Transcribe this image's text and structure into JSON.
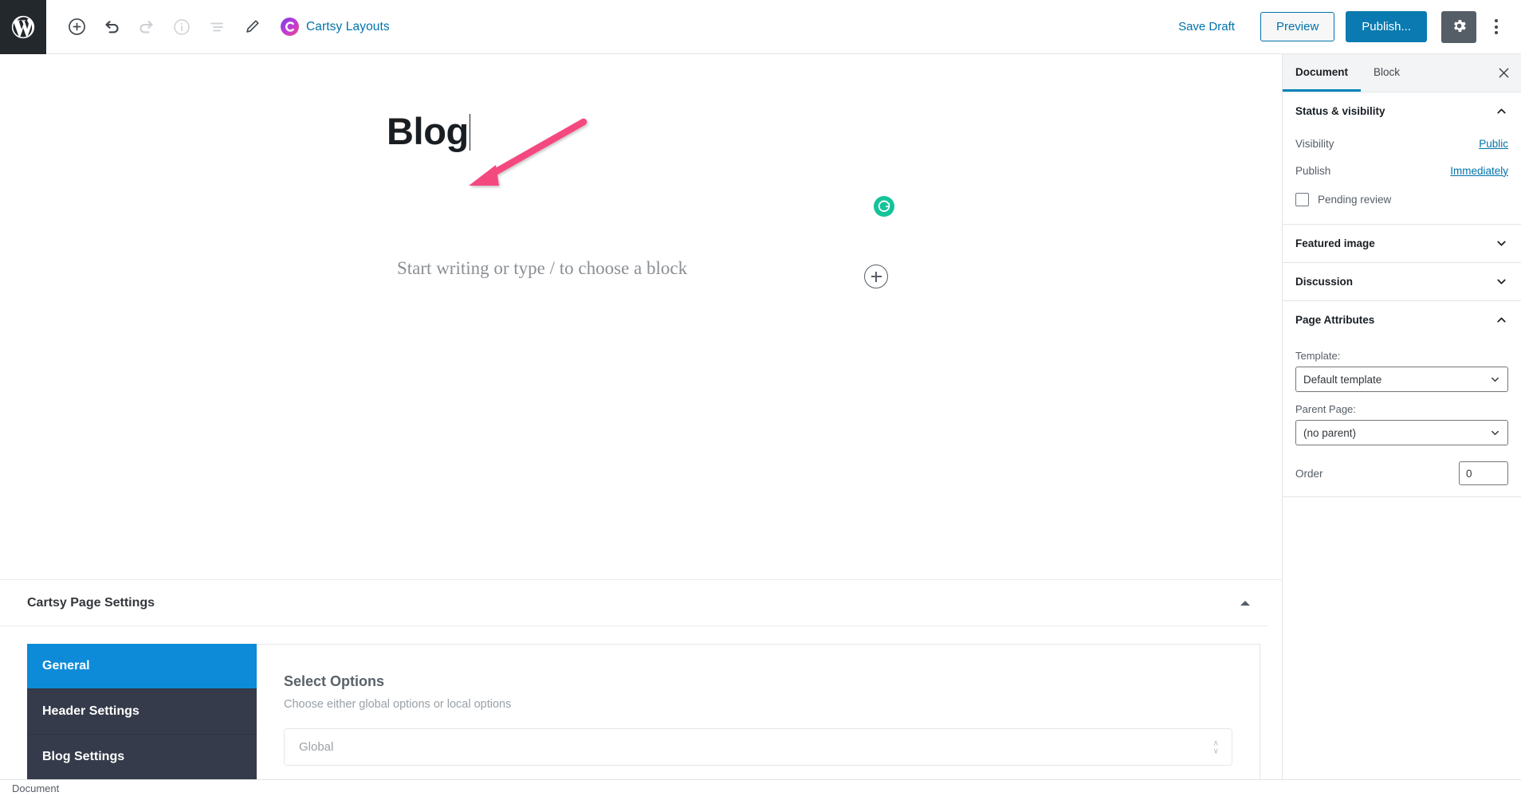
{
  "toolbar": {
    "wp_logo_icon": "wordpress-logo-icon",
    "left_tools": [
      {
        "name": "add-block-button",
        "icon": "plus-circle-icon",
        "disabled": false
      },
      {
        "name": "undo-button",
        "icon": "undo-arrow-icon",
        "disabled": false
      },
      {
        "name": "redo-button",
        "icon": "redo-arrow-icon",
        "disabled": true
      },
      {
        "name": "content-structure-button",
        "icon": "info-circle-icon",
        "disabled": true
      },
      {
        "name": "block-navigation-button",
        "icon": "list-view-icon",
        "disabled": true
      },
      {
        "name": "edit-mode-button",
        "icon": "pencil-icon",
        "disabled": false
      }
    ],
    "brand_label": "Cartsy Layouts",
    "brand_icon": "cartsy-logo-icon",
    "save_draft_label": "Save Draft",
    "preview_label": "Preview",
    "publish_label": "Publish...",
    "settings_icon": "gear-icon",
    "more_menu_icon": "kebab-menu-icon"
  },
  "editor": {
    "post_title": "Blog",
    "block_placeholder": "Start writing or type / to choose a block",
    "grammarly_icon": "grammarly-icon",
    "inserter_icon": "plus-circle-icon",
    "annotation": {
      "type": "arrow",
      "color": "#f4487f",
      "points_to": "post-title"
    }
  },
  "metabox": {
    "title": "Cartsy Page Settings",
    "toggle_icon": "collapse-triangle-icon",
    "tabs": [
      {
        "label": "General",
        "active": true
      },
      {
        "label": "Header Settings",
        "active": false
      },
      {
        "label": "Blog Settings",
        "active": false
      }
    ],
    "panel": {
      "heading": "Select Options",
      "description": "Choose either global options or local options",
      "select_value": "Global",
      "select_icon": "updown-stepper-icon"
    }
  },
  "sidebar": {
    "tabs": [
      {
        "label": "Document",
        "active": true
      },
      {
        "label": "Block",
        "active": false
      }
    ],
    "close_icon": "close-icon",
    "panels": [
      {
        "title": "Status & visibility",
        "expanded": true,
        "chevron_icon": "chevron-up-icon",
        "rows": [
          {
            "label": "Visibility",
            "value": "Public"
          },
          {
            "label": "Publish",
            "value": "Immediately"
          }
        ],
        "checkbox": {
          "label": "Pending review",
          "checked": false
        }
      },
      {
        "title": "Featured image",
        "expanded": false,
        "chevron_icon": "chevron-down-icon"
      },
      {
        "title": "Discussion",
        "expanded": false,
        "chevron_icon": "chevron-down-icon"
      },
      {
        "title": "Page Attributes",
        "expanded": true,
        "chevron_icon": "chevron-up-icon",
        "template_label": "Template:",
        "template_value": "Default template",
        "parent_label": "Parent Page:",
        "parent_value": "(no parent)",
        "order_label": "Order",
        "order_value": "0"
      }
    ]
  },
  "statusbar": {
    "text": "Document"
  },
  "colors": {
    "wp_admin_dark": "#23282d",
    "link_blue": "#0073aa",
    "publish_blue": "#0a7ab0",
    "tab_active_blue": "#0d8bd9",
    "tab_rail_dark": "#353b4a",
    "grammarly_green": "#15c39a",
    "annotation_pink": "#f4487f",
    "gear_gray": "#555d66"
  }
}
